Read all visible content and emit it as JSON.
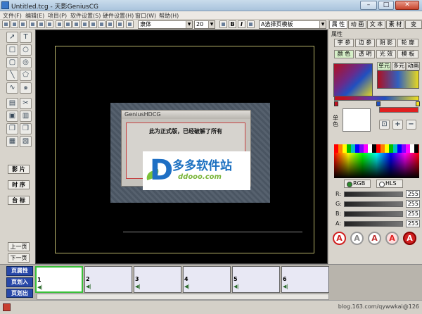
{
  "window": {
    "title": "Untitled.tcg - 天影GeniusCG",
    "min": "–",
    "max": "□",
    "close": "✕"
  },
  "menu": [
    "文件(F)",
    "编辑(E)",
    "项目(P)",
    "软件设置(S)",
    "硬件设置(H)",
    "窗口(W)",
    "帮助(H)"
  ],
  "toolbar": {
    "font": "隶体",
    "size": "20",
    "bold": "B",
    "italic": "I",
    "template": "A选择页模板"
  },
  "left": {
    "buttons": [
      "影 片",
      "时 序",
      "台 标"
    ],
    "prev": "上一页",
    "next": "下一页"
  },
  "dialog": {
    "title": "GeniusHDCG",
    "message": "此为正式版，已经破解了所有"
  },
  "watermark_logo": {
    "main": "多多软件站",
    "sub": "ddooo.com"
  },
  "right": {
    "tabs": [
      "属 性",
      "动 画",
      "文 本",
      "素 材",
      "变 "
    ],
    "panel_title": "属性",
    "subtabs": [
      "字 参",
      "边 参",
      "阴 影",
      "轮 廓"
    ],
    "subtabs2": [
      "颜 色",
      "透 明",
      "光 效",
      "模 板"
    ],
    "modes": [
      "单元",
      "多元",
      "动画"
    ],
    "single_label": "单色",
    "plus": "+",
    "minus": "−",
    "rgb": "RGB",
    "hls": "HLS",
    "channels": [
      {
        "label": "R:",
        "value": "255"
      },
      {
        "label": "G:",
        "value": "255"
      },
      {
        "label": "B:",
        "value": "255"
      },
      {
        "label": "A:",
        "value": "255"
      }
    ],
    "style_glyph": "A"
  },
  "timeline": {
    "buttons": [
      "页属性",
      "页划入",
      "页划出"
    ],
    "frames": [
      "1",
      "2",
      "3",
      "4",
      "5",
      "6"
    ],
    "frame_icon": "◀|"
  },
  "status": {
    "watermark": "blog.163.com/qywwkai@126"
  }
}
